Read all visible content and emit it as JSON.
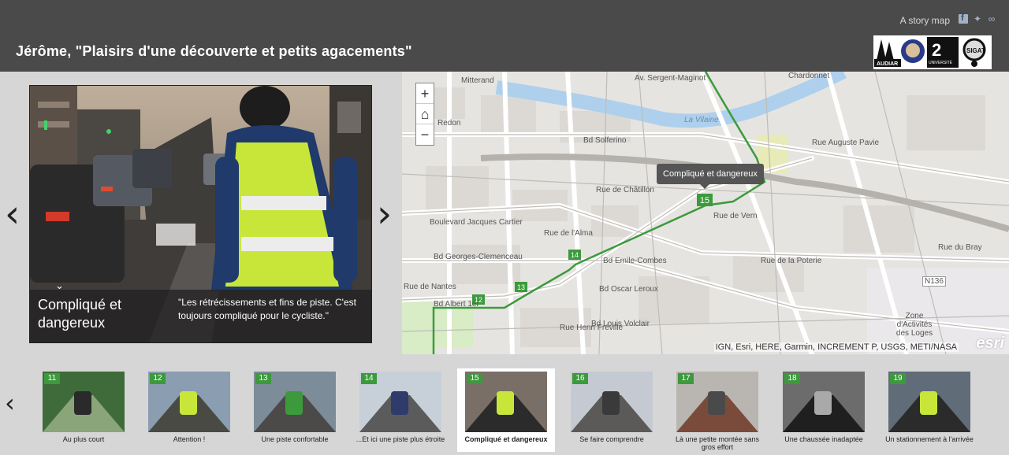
{
  "header": {
    "title": "Jérôme, \"Plaisirs d'une découverte et petits agacements\"",
    "storymap_label": "A story map",
    "social": [
      "facebook-icon",
      "twitter-icon",
      "link-icon"
    ]
  },
  "current": {
    "title": "Compliqué et dangereux",
    "quote": "\"Les rétrécissements et fins de piste. C'est toujours compliqué pour le cycliste.\""
  },
  "map": {
    "popup": "Compliqué et dangereux",
    "attribution": "IGN, Esri, HERE, Garmin, INCREMENT P, USGS, METI/NASA",
    "esri": "esri",
    "zoom_in": "+",
    "zoom_out": "−",
    "labels": [
      "Av. Sergent-Maginot",
      "Chardonnet",
      "La Vilaine",
      "Rue Auguste Pavie",
      "Bd Solferino",
      "Redon",
      "Mitterand",
      "Boulevard Jacques Cartier",
      "Bd Georges-Clemenceau",
      "Bd Emile-Combes",
      "Rue de Vern",
      "Bd Oscar Leroux",
      "Bd Louis Volclair",
      "Rue de la Poterie",
      "Bd Albert 1er",
      "Rue de Nantes",
      "Zone d'Activités des Loges",
      "Rue de Châtillon",
      "Rue de l'Alma",
      "Rue Henri Fréville",
      "N136",
      "Rue du Bray"
    ],
    "markers": [
      "12",
      "13",
      "14",
      "15"
    ]
  },
  "slides": [
    {
      "num": "11",
      "label": "Au plus court"
    },
    {
      "num": "12",
      "label": "Attention !"
    },
    {
      "num": "13",
      "label": "Une piste confortable"
    },
    {
      "num": "14",
      "label": "...Et ici une piste plus étroite"
    },
    {
      "num": "15",
      "label": "Compliqué et dangereux"
    },
    {
      "num": "16",
      "label": "Se faire comprendre"
    },
    {
      "num": "17",
      "label": "Là une petite montée sans gros effort"
    },
    {
      "num": "18",
      "label": "Une chaussée inadaptée"
    },
    {
      "num": "19",
      "label": "Un stationnement à l'arrivée"
    }
  ],
  "colors": {
    "header_bg": "#4a4a4a",
    "route_green": "#3c9a3c",
    "map_bg": "#eeecea",
    "vest": "#c8e63a"
  },
  "logo_text": [
    "AUDIAR",
    "UNIVERSITÉ RENNES 2",
    "ESIGAT"
  ]
}
